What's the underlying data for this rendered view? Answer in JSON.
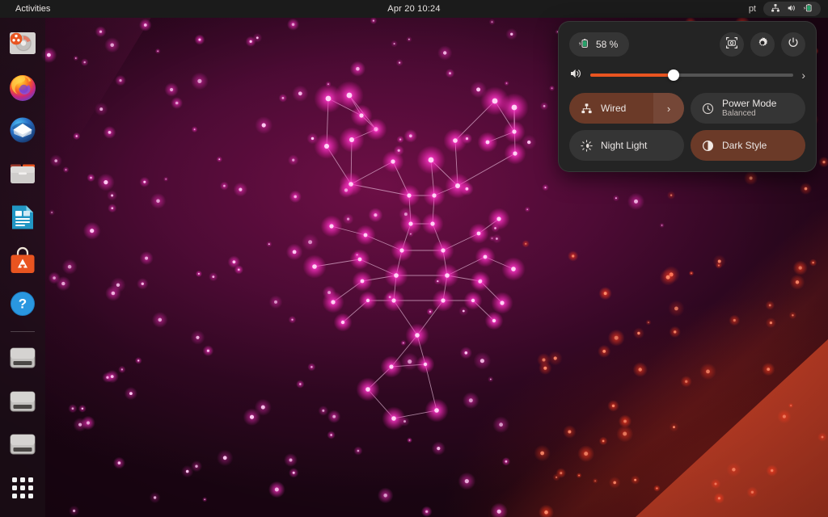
{
  "topbar": {
    "activities_label": "Activities",
    "clock": "Apr 20  10:24",
    "keyboard_layout": "pt",
    "indicators": [
      "network-wired-icon",
      "volume-icon",
      "battery-charging-icon"
    ]
  },
  "dock": {
    "items": [
      {
        "name": "ubuntu-installer",
        "label": "Install Ubuntu",
        "icon": "disk-installer-icon"
      },
      {
        "name": "firefox",
        "label": "Firefox Web Browser",
        "icon": "firefox-icon"
      },
      {
        "name": "thunderbird",
        "label": "Thunderbird Mail",
        "icon": "thunderbird-icon"
      },
      {
        "name": "files",
        "label": "Files",
        "icon": "folder-icon"
      },
      {
        "name": "libreoffice-impress",
        "label": "LibreOffice Impress",
        "icon": "impress-icon"
      },
      {
        "name": "ubuntu-software",
        "label": "Ubuntu Software",
        "icon": "software-bag-icon"
      },
      {
        "name": "help",
        "label": "Help",
        "icon": "help-question-icon"
      }
    ],
    "drives": [
      {
        "name": "drive-1",
        "label": "Removable Drive",
        "icon": "drive-media-icon"
      },
      {
        "name": "drive-2",
        "label": "Removable Drive",
        "icon": "drive-media-icon"
      },
      {
        "name": "drive-3",
        "label": "Removable Drive",
        "icon": "drive-media-icon"
      }
    ],
    "app_grid_label": "Show Applications"
  },
  "quick_settings": {
    "battery": {
      "percent_label": "58 %",
      "icon": "battery-charging-icon"
    },
    "actions": [
      {
        "name": "screenshot-button",
        "icon": "screenshot-icon"
      },
      {
        "name": "settings-button",
        "icon": "gear-icon"
      },
      {
        "name": "power-button",
        "icon": "power-icon"
      }
    ],
    "volume": {
      "icon": "volume-icon",
      "level": 41,
      "expand_icon": "chevron-right-icon"
    },
    "tiles": [
      {
        "name": "wired",
        "label": "Wired",
        "sublabel": "",
        "icon": "network-wired-icon",
        "active": true,
        "has_arrow": true
      },
      {
        "name": "power-mode",
        "label": "Power Mode",
        "sublabel": "Balanced",
        "icon": "power-mode-icon",
        "active": false,
        "has_arrow": false
      },
      {
        "name": "night-light",
        "label": "Night Light",
        "sublabel": "",
        "icon": "night-light-icon",
        "active": false,
        "has_arrow": false
      },
      {
        "name": "dark-style",
        "label": "Dark Style",
        "sublabel": "",
        "icon": "dark-style-icon",
        "active": true,
        "has_arrow": false
      }
    ]
  },
  "colors": {
    "accent_orange": "#E95420",
    "panel_bg": "#242424",
    "topbar_bg": "#1b1b1b",
    "tile_active": "#6b3a28",
    "star_pink": "#ff2ec4"
  }
}
